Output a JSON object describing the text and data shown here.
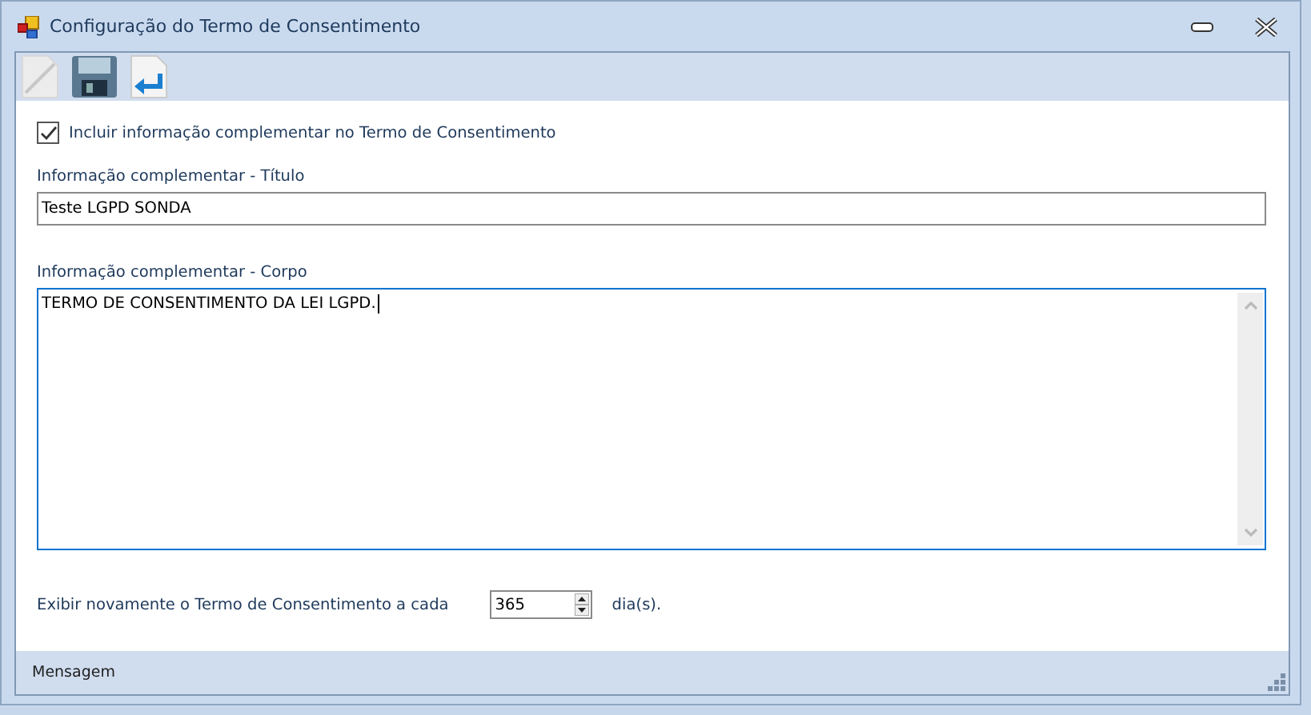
{
  "window": {
    "title": "Configuração do Termo de Consentimento"
  },
  "include_checkbox": {
    "label": "Incluir informação complementar no Termo de Consentimento",
    "checked": true
  },
  "title_field": {
    "label": "Informação complementar - Título",
    "value": "Teste LGPD SONDA"
  },
  "body_field": {
    "label": "Informação complementar - Corpo",
    "value": "TERMO DE CONSENTIMENTO DA LEI LGPD."
  },
  "repeat": {
    "label": "Exibir novamente o Termo de Consentimento a cada",
    "value": "365",
    "unit": "dia(s)."
  },
  "status_bar": {
    "text": "Mensagem"
  }
}
